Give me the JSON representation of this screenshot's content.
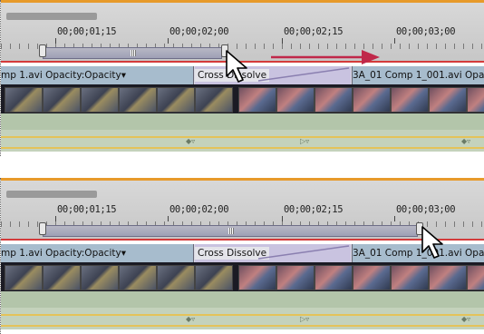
{
  "panels": [
    {
      "id": "before",
      "timecodes": [
        "00;00;01;15",
        "00;00;02;00",
        "00;00;02;15",
        "00;00;03;00"
      ],
      "clips": {
        "left_label": "mp 1.avi Opacity:Opacity",
        "dropdown_glyph": "▾",
        "transition_label": "Cross Dissolve",
        "right_label": "3A_01 Comp 1_001.avi Opa"
      },
      "annotation": "drag-right-arrow",
      "pointer_icon": "arrow-cursor-icon"
    },
    {
      "id": "after",
      "timecodes": [
        "00;00;01;15",
        "00;00;02;00",
        "00;00;02;15",
        "00;00;03;00"
      ],
      "clips": {
        "left_label": "mp 1.avi Opacity:Opacity",
        "dropdown_glyph": "▾",
        "transition_label": "Cross Dissolve",
        "right_label": "3A_01 Comp 1_001.avi Opa"
      },
      "pointer_icon": "arrow-cursor-icon"
    }
  ],
  "colors": {
    "current_time_line": "#d43b3b",
    "drag_arrow": "#c0284a",
    "clip_blue": "#a7bccd",
    "transition_purple": "#c9c3e0",
    "track_green": "#b3c5aa",
    "accent_orange": "#e79a2a"
  }
}
